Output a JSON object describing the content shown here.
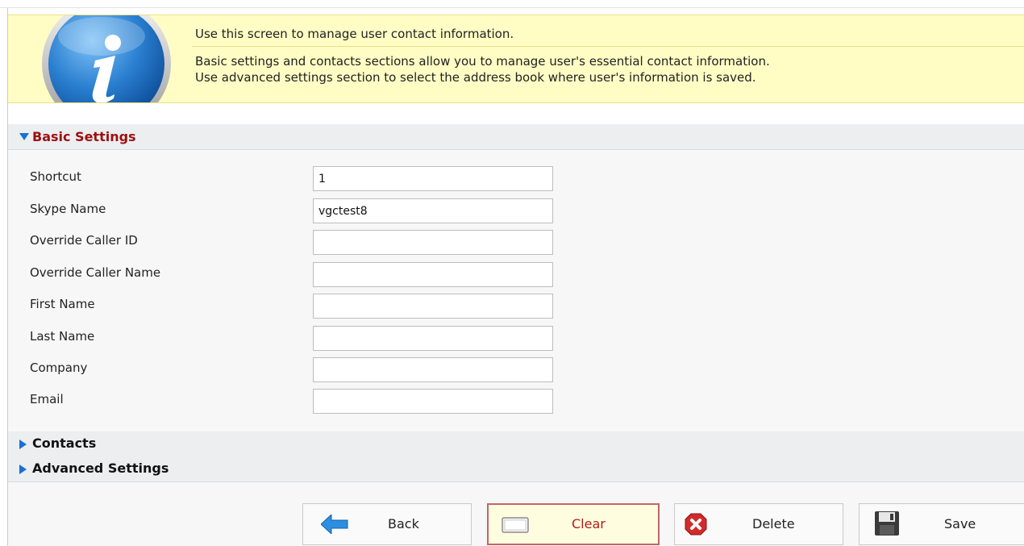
{
  "info": {
    "icon": "info-icon",
    "line1": "Use this screen to manage user contact information.",
    "line2": "Basic settings and contacts sections allow you to manage user's essential contact information.",
    "line3": "Use advanced settings section to select the address book where user's information is saved."
  },
  "sections": {
    "basic": {
      "title": "Basic Settings",
      "expanded": true
    },
    "contacts": {
      "title": "Contacts",
      "expanded": false
    },
    "advanced": {
      "title": "Advanced Settings",
      "expanded": false
    }
  },
  "fields": {
    "shortcut": {
      "label": "Shortcut",
      "value": "1"
    },
    "skype_name": {
      "label": "Skype Name",
      "value": "vgctest8"
    },
    "override_caller_id": {
      "label": "Override Caller ID",
      "value": ""
    },
    "override_caller_name": {
      "label": "Override Caller Name",
      "value": ""
    },
    "first_name": {
      "label": "First Name",
      "value": ""
    },
    "last_name": {
      "label": "Last Name",
      "value": ""
    },
    "company": {
      "label": "Company",
      "value": ""
    },
    "email": {
      "label": "Email",
      "value": ""
    }
  },
  "buttons": {
    "back": {
      "label": "Back",
      "icon": "arrow-left-icon"
    },
    "clear": {
      "label": "Clear",
      "icon": "eraser-icon"
    },
    "delete": {
      "label": "Delete",
      "icon": "delete-x-icon"
    },
    "save": {
      "label": "Save",
      "icon": "floppy-disk-icon"
    }
  },
  "colors": {
    "banner_bg": "#fffdc4",
    "section_title_active": "#9d0f0f",
    "expander_arrow": "#1a6ed8",
    "clear_border": "#c26565"
  }
}
